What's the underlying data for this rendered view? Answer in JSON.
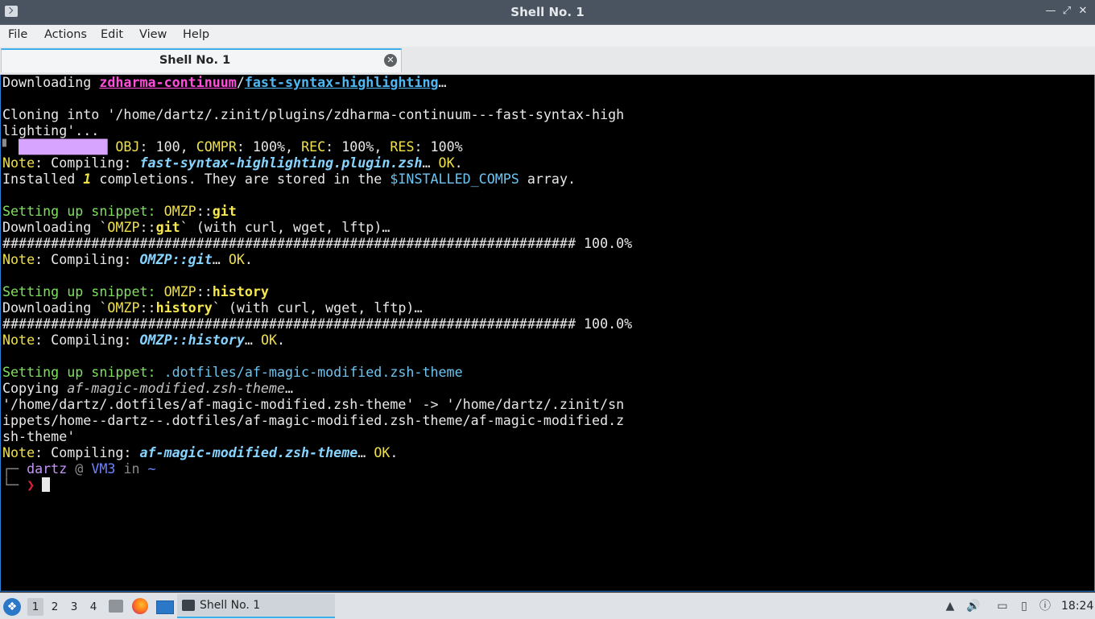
{
  "window": {
    "title": "Shell No. 1"
  },
  "menu": [
    "File",
    "Actions",
    "Edit",
    "View",
    "Help"
  ],
  "tab": {
    "label": "Shell No. 1",
    "close_icon": "close-circle-icon"
  },
  "terminal_lines": [
    [
      [
        "w",
        "Downloading "
      ],
      [
        "pu",
        "zdharma-continuum"
      ],
      [
        "w",
        "/"
      ],
      [
        "cu",
        "fast-syntax-highlighting"
      ],
      [
        "w",
        "…"
      ]
    ],
    [],
    [
      [
        "w",
        "Cloning into '/home/dartz/.zinit/plugins/zdharma-continuum---fast-syntax-high"
      ]
    ],
    [
      [
        "w",
        "lighting'..."
      ]
    ],
    [
      [
        "dk",
        "▘ "
      ],
      [
        "bar",
        "███████████"
      ],
      [
        "w",
        " "
      ],
      [
        "y",
        "OBJ"
      ],
      [
        "w",
        ": 100, "
      ],
      [
        "y",
        "COMPR"
      ],
      [
        "w",
        ": 100%, "
      ],
      [
        "y",
        "REC"
      ],
      [
        "w",
        ": 100%, "
      ],
      [
        "y",
        "RES"
      ],
      [
        "w",
        ": 100%"
      ]
    ],
    [
      [
        "y",
        "Note"
      ],
      [
        "w",
        ": Compiling: "
      ],
      [
        "ci",
        "fast-syntax-highlighting.plugin.zsh"
      ],
      [
        "w",
        "… "
      ],
      [
        "y",
        "OK"
      ],
      [
        "w",
        "."
      ]
    ],
    [
      [
        "w",
        "Installed "
      ],
      [
        "yi",
        "1"
      ],
      [
        "w",
        " completions. They are stored in the "
      ],
      [
        "c",
        "$INSTALLED_COMPS"
      ],
      [
        "w",
        " array."
      ]
    ],
    [],
    [
      [
        "g",
        "Setting up snippet: "
      ],
      [
        "y",
        "OMZP"
      ],
      [
        "w",
        "::"
      ],
      [
        "yb",
        "git"
      ]
    ],
    [
      [
        "w",
        "Downloading `"
      ],
      [
        "y",
        "OMZP"
      ],
      [
        "w",
        "::"
      ],
      [
        "yb",
        "git"
      ],
      [
        "w",
        "` (with curl, wget, lftp)…"
      ]
    ],
    [
      [
        "w",
        "####################################################################### 100.0%"
      ]
    ],
    [
      [
        "y",
        "Note"
      ],
      [
        "w",
        ": Compiling: "
      ],
      [
        "ci",
        "OMZP::git"
      ],
      [
        "w",
        "… "
      ],
      [
        "y",
        "OK"
      ],
      [
        "w",
        "."
      ]
    ],
    [],
    [
      [
        "g",
        "Setting up snippet: "
      ],
      [
        "y",
        "OMZP"
      ],
      [
        "w",
        "::"
      ],
      [
        "yb",
        "history"
      ]
    ],
    [
      [
        "w",
        "Downloading `"
      ],
      [
        "y",
        "OMZP"
      ],
      [
        "w",
        "::"
      ],
      [
        "yb",
        "history"
      ],
      [
        "w",
        "` (with curl, wget, lftp)…"
      ]
    ],
    [
      [
        "w",
        "####################################################################### 100.0%"
      ]
    ],
    [
      [
        "y",
        "Note"
      ],
      [
        "w",
        ": Compiling: "
      ],
      [
        "ci",
        "OMZP::history"
      ],
      [
        "w",
        "… "
      ],
      [
        "y",
        "OK"
      ],
      [
        "w",
        "."
      ]
    ],
    [],
    [
      [
        "g",
        "Setting up snippet: "
      ],
      [
        "c",
        ".dotfiles/af-magic-modified.zsh-theme"
      ]
    ],
    [
      [
        "w",
        "Copying "
      ],
      [
        "ii",
        "af-magic-modified.zsh-theme"
      ],
      [
        "w",
        "…"
      ]
    ],
    [
      [
        "w",
        "'/home/dartz/.dotfiles/af-magic-modified.zsh-theme' -> '/home/dartz/.zinit/sn"
      ]
    ],
    [
      [
        "w",
        "ippets/home--dartz--.dotfiles/af-magic-modified.zsh-theme/af-magic-modified.z"
      ]
    ],
    [
      [
        "w",
        "sh-theme'"
      ]
    ],
    [
      [
        "y",
        "Note"
      ],
      [
        "w",
        ": Compiling: "
      ],
      [
        "ci",
        "af-magic-modified.zsh-theme"
      ],
      [
        "w",
        "… "
      ],
      [
        "y",
        "OK"
      ],
      [
        "w",
        "."
      ]
    ],
    [
      [
        "dk",
        "┌─ "
      ],
      [
        "pr",
        "dartz"
      ],
      [
        "dk",
        " @ "
      ],
      [
        "bl",
        "VM3"
      ],
      [
        "dk",
        " in "
      ],
      [
        "bl",
        "~"
      ]
    ],
    [
      [
        "dk",
        "└─ "
      ],
      [
        "red",
        "❯"
      ],
      [
        "w",
        " "
      ]
    ]
  ],
  "taskbar": {
    "workspaces": [
      "1",
      "2",
      "3",
      "4"
    ],
    "task_label": "Shell No. 1",
    "clock": "18:24"
  },
  "colors": {
    "accent": "#3daee9",
    "titlebar": "#4a5360",
    "terminal_bg": "#000000"
  }
}
